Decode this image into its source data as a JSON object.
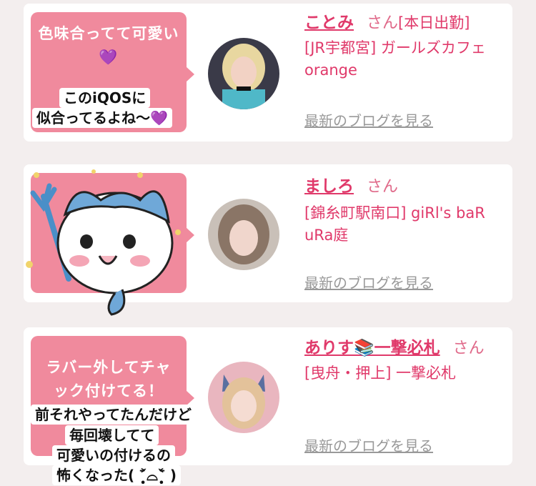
{
  "cards": [
    {
      "bubble": "色味合ってて可愛い💜",
      "name": "ことみ",
      "san": "さん",
      "tag": "[本日出勤]",
      "shop": "[JR宇都宮] ガールズカフェ orange",
      "blog": "最新のブログを見る",
      "sticker": [
        "このiQOSに",
        "似合ってるよね〜💜"
      ]
    },
    {
      "bubble": "",
      "name": "ましろ",
      "san": "さん",
      "shop": "[錦糸町駅南口] giRl's baR uRa庭",
      "blog": "最新のブログを見る"
    },
    {
      "bubble": "ラバー外してチャック付けてる！",
      "name": "ありす📚一撃必札",
      "san": "さん",
      "shop": "[曳舟・押上] 一撃必札",
      "blog": "最新のブログを見る",
      "sticker": [
        "前それやってたんだけど",
        "毎回壊してて",
        "可愛いの付けるの",
        "怖くなった( ˃̣̣̥᷄⌓˂̣̣̥᷅ )"
      ]
    }
  ],
  "colors": {
    "accent": "#e0396a",
    "bubble": "#f08a9d",
    "link_gray": "#999999"
  },
  "icons": [
    "hand-drawn-cat-character-sticker",
    "avatar-photo"
  ]
}
